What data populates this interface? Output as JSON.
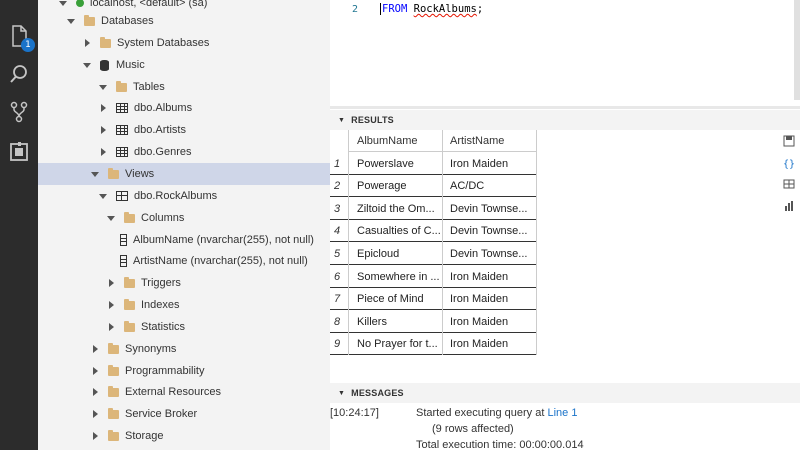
{
  "activity_bar": {
    "items": [
      {
        "icon": "files-icon",
        "badge": "1"
      },
      {
        "icon": "search-icon"
      },
      {
        "icon": "source-control-icon"
      },
      {
        "icon": "extensions-icon"
      }
    ]
  },
  "explorer": {
    "connection": "localhost, <default> (sa)",
    "tree": [
      {
        "label": "Databases",
        "icon": "folder-icon",
        "expanded": true
      },
      {
        "label": "System Databases",
        "icon": "folder-icon",
        "expanded": false
      },
      {
        "label": "Music",
        "icon": "database-icon",
        "expanded": true
      },
      {
        "label": "Tables",
        "icon": "folder-icon",
        "expanded": true
      },
      {
        "label": "dbo.Albums",
        "icon": "table-icon",
        "expanded": false
      },
      {
        "label": "dbo.Artists",
        "icon": "table-icon",
        "expanded": false
      },
      {
        "label": "dbo.Genres",
        "icon": "table-icon",
        "expanded": false
      },
      {
        "label": "Views",
        "icon": "folder-icon",
        "expanded": true,
        "selected": true
      },
      {
        "label": "dbo.RockAlbums",
        "icon": "view-icon",
        "expanded": true
      },
      {
        "label": "Columns",
        "icon": "folder-icon",
        "expanded": true
      },
      {
        "label": "AlbumName (nvarchar(255), not null)",
        "icon": "column-icon"
      },
      {
        "label": "ArtistName (nvarchar(255), not null)",
        "icon": "column-icon"
      },
      {
        "label": "Triggers",
        "icon": "folder-icon",
        "expanded": false
      },
      {
        "label": "Indexes",
        "icon": "folder-icon",
        "expanded": false
      },
      {
        "label": "Statistics",
        "icon": "folder-icon",
        "expanded": false
      },
      {
        "label": "Synonyms",
        "icon": "folder-icon",
        "expanded": false
      },
      {
        "label": "Programmability",
        "icon": "folder-icon",
        "expanded": false
      },
      {
        "label": "External Resources",
        "icon": "folder-icon",
        "expanded": false
      },
      {
        "label": "Service Broker",
        "icon": "folder-icon",
        "expanded": false
      },
      {
        "label": "Storage",
        "icon": "folder-icon",
        "expanded": false
      }
    ]
  },
  "editor": {
    "line_number": "2",
    "keyword": "FROM",
    "table_name": "RockAlbums",
    "terminator": ";"
  },
  "results": {
    "title": "RESULTS",
    "columns": [
      "AlbumName",
      "ArtistName"
    ],
    "rows": [
      {
        "num": "1",
        "album": "Powerslave",
        "artist": "Iron Maiden"
      },
      {
        "num": "2",
        "album": "Powerage",
        "artist": "AC/DC"
      },
      {
        "num": "3",
        "album": "Ziltoid the Om...",
        "artist": "Devin Townse..."
      },
      {
        "num": "4",
        "album": "Casualties of C...",
        "artist": "Devin Townse..."
      },
      {
        "num": "5",
        "album": "Epicloud",
        "artist": "Devin Townse..."
      },
      {
        "num": "6",
        "album": "Somewhere in ...",
        "artist": "Iron Maiden"
      },
      {
        "num": "7",
        "album": "Piece of Mind",
        "artist": "Iron Maiden"
      },
      {
        "num": "8",
        "album": "Killers",
        "artist": "Iron Maiden"
      },
      {
        "num": "9",
        "album": "No Prayer for t...",
        "artist": "Iron Maiden"
      }
    ]
  },
  "messages": {
    "title": "MESSAGES",
    "timestamp": "[10:24:17]",
    "started": "Started executing query at ",
    "line_link": "Line 1",
    "rows_affected": "(9 rows affected)",
    "execution_time": "Total execution time: 00:00:00.014"
  },
  "colors": {
    "activity_bar": "#2c2c2c",
    "sidebar": "#f3f3f3",
    "selection": "#cfd6e8",
    "folder": "#dcb67a",
    "keyword": "#0000ff",
    "link": "#1a73c9",
    "badge": "#1a73c9"
  }
}
